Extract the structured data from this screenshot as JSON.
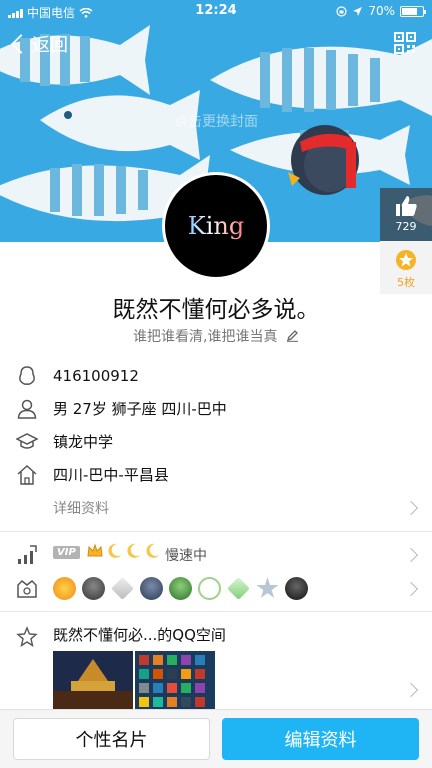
{
  "status_bar": {
    "carrier": "中国电信",
    "time": "12:24",
    "battery": "70%"
  },
  "nav": {
    "back_label": "返回"
  },
  "cover": {
    "hint": "点击更换封面"
  },
  "side_stats": {
    "likes": "729",
    "medals": "5枚"
  },
  "profile": {
    "avatar_text": "King",
    "nickname": "既然不懂何必多说。",
    "signature": "谁把谁看清,谁把谁当真"
  },
  "info": {
    "qq_number": "416100912",
    "personal": "男 27岁 狮子座 四川-巴中",
    "school": "镇龙中学",
    "hometown": "四川-巴中-平昌县",
    "details_label": "详细资料"
  },
  "vip": {
    "badge": "VIP",
    "speed": "慢速中"
  },
  "qzone": {
    "title": "既然不懂何必...的QQ空间"
  },
  "actions": {
    "card_label": "个性名片",
    "edit_label": "编辑资料"
  },
  "colors": {
    "accent": "#1fb5f5",
    "cover_bg": "#38a9e2"
  }
}
